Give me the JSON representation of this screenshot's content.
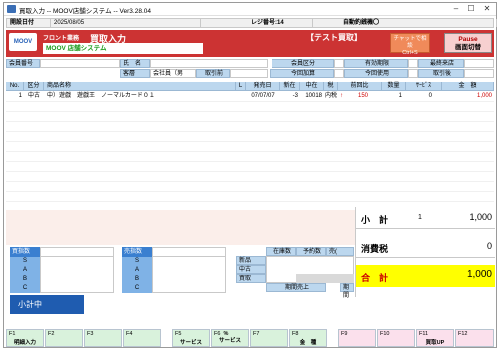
{
  "window": {
    "title": "買取入力 -- MOOV店舗システム -- Ver3.28.04"
  },
  "statusbar": {
    "open_date_label": "開設日付",
    "open_date": "2025/08/05",
    "register_label": "レジ番号:14",
    "auto_print_label": "自動釣銭機〇"
  },
  "header": {
    "logo": "MOOV",
    "front": "フロント業務",
    "title": "買取入力",
    "store": "MOOV 店舗システム",
    "test_mode": "【テスト買取】",
    "chat_label": "チャットで相談",
    "chat_key": "Ctrl+S",
    "pause_label": "Pause",
    "pause_sub": "画面切替"
  },
  "customer": {
    "member_no_label": "会員番号",
    "name_label": "氏　名",
    "type_label": "客層",
    "type_value": "会社員（男",
    "trade_label": "取引前",
    "member_class_label": "会員区分",
    "this_time_add_label": "今回加算",
    "this_time_use_label": "今回使用",
    "valid_period_label": "有効期限",
    "last_visit_label": "最終来店",
    "after_trade_label": "取引後"
  },
  "table": {
    "headers": [
      "No.",
      "区分",
      "商品名称",
      "L",
      "発売日",
      "新在",
      "中在",
      "税",
      "前回比",
      "数量",
      "ｻｰﾋﾞｽ",
      "金　額"
    ],
    "row": {
      "no": "1",
      "kubun": "中古",
      "name": "中）遊戯　遊戯王　ノーマルカード０１",
      "release": "07/07/07",
      "new_stock": "-3",
      "used_stock": "10018",
      "tax": "内税",
      "arrow": "↑",
      "prev": "150",
      "qty": "1",
      "service": "0",
      "amount": "1,000"
    }
  },
  "totals": {
    "subtotal_label": "小　計",
    "subtotal_qty": "1",
    "subtotal": "1,000",
    "tax_label": "消費税",
    "tax": "0",
    "total_label": "合　計",
    "total": "1,000"
  },
  "panels": {
    "buy_label": "買指数",
    "sell_label": "売指数",
    "rows": [
      "S",
      "A",
      "B",
      "C"
    ],
    "stock_label": "在庫数",
    "reserve_label": "予約数",
    "sell_num_label": "売(",
    "new_label": "新品",
    "used_label": "中古",
    "buyback_label": "買取",
    "period_sales_label": "期間売上",
    "period_label": "期間"
  },
  "subtotal_bar": "小計中",
  "fkeys": [
    {
      "key": "F1",
      "label": "明細入力"
    },
    {
      "key": "F2",
      "label": ""
    },
    {
      "key": "F3",
      "label": ""
    },
    {
      "key": "F4",
      "label": ""
    },
    {
      "key": "F5",
      "label": "サービス"
    },
    {
      "key": "F6",
      "label": "サービス",
      "extra": "%"
    },
    {
      "key": "F7",
      "label": ""
    },
    {
      "key": "F8",
      "label": "金　種"
    },
    {
      "key": "F9",
      "label": ""
    },
    {
      "key": "F10",
      "label": ""
    },
    {
      "key": "F11",
      "label": "買取UP"
    },
    {
      "key": "F12",
      "label": ""
    }
  ],
  "colors": {
    "header_red": "#cc3333",
    "total_yellow": "#ffff00",
    "label_blue": "#bcd7ee",
    "panel_blue": "#3a7fd0",
    "fkey_green": "#d9f2dc",
    "fkey_pink": "#fbe0ec"
  }
}
